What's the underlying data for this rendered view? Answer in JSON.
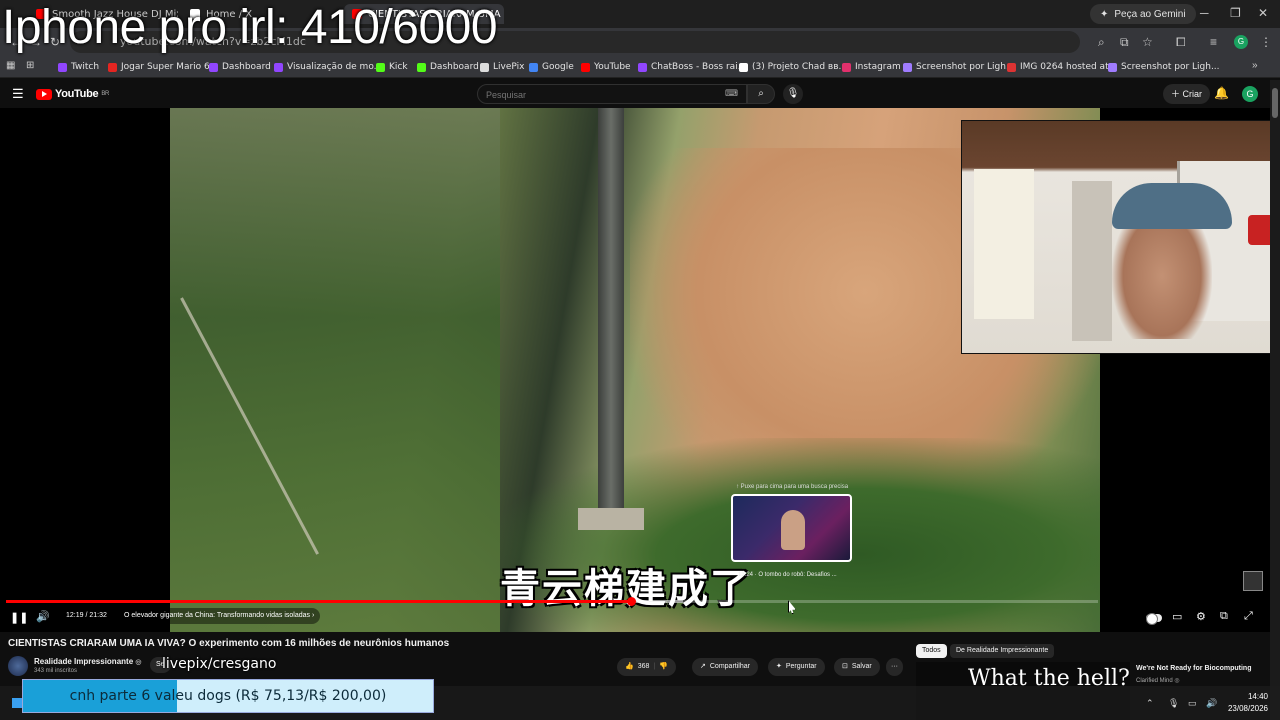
{
  "overlay": {
    "stream_title": "Iphone pro irl: 410/6000",
    "pix_text": "livepix/cresgano"
  },
  "browser": {
    "tabs": [
      {
        "label": "Smooth Jazz House DJ Mix - Ca",
        "favicon": "youtube-icon",
        "color": "#ff0000"
      },
      {
        "label": "Home / X",
        "favicon": "x-icon",
        "color": "#ffffff"
      },
      {
        "label": "CIENTISTAS CRIARAM UMA IA VIVA?",
        "favicon": "youtube-icon",
        "color": "#ff0000"
      }
    ],
    "gemini_label": "Peça ao Gemini",
    "url": "youtube.com/watch?v=zb2cM1dc",
    "bookmarks": [
      {
        "label": "Twitch",
        "color": "#9146ff"
      },
      {
        "label": "Jogar Super Mario 6...",
        "color": "#e52521"
      },
      {
        "label": "Dashboard",
        "color": "#9146ff"
      },
      {
        "label": "Visualização de mo...",
        "color": "#9146ff"
      },
      {
        "label": "Kick",
        "color": "#53fc18"
      },
      {
        "label": "Dashboard",
        "color": "#53fc18"
      },
      {
        "label": "LivePix",
        "color": "#dddddd"
      },
      {
        "label": "Google",
        "color": "#4285f4"
      },
      {
        "label": "YouTube",
        "color": "#ff0000"
      },
      {
        "label": "ChatBoss - Boss rai...",
        "color": "#9146ff"
      },
      {
        "label": "(3) Projeto Chad вв...",
        "color": "#ffffff"
      },
      {
        "label": "Instagram",
        "color": "#e1306c"
      },
      {
        "label": "Screenshot por Ligh...",
        "color": "#a07cff"
      },
      {
        "label": "IMG 0264 hosted at...",
        "color": "#d33"
      },
      {
        "label": "Screenshot por Ligh...",
        "color": "#a07cff"
      }
    ]
  },
  "youtube": {
    "logo_text": "YouTube",
    "logo_region": "BR",
    "search_placeholder": "Pesquisar",
    "create_label": "Criar",
    "avatar_letter": "G"
  },
  "player": {
    "subtitle": "青云梯建成了",
    "preview_hint": "↑ Puxe para cima para uma busca precisa",
    "preview_caption": "13:24 · O tombo do robô: Desafios ...",
    "time": "12:19 / 21:32",
    "chapter": "O elevador gigante da China: Transformando vidas isoladas ›",
    "progress_fraction": 0.572,
    "buffer_fraction": 0.62
  },
  "video": {
    "title": "CIENTISTAS CRIARAM UMA IA VIVA? O experimento com 16 milhões de neurônios humanos",
    "channel_name": "Realidade Impressionante",
    "channel_verified": "◎",
    "subscribers": "343 mil inscritos",
    "subscribe_label": "Se",
    "likes": "368",
    "share_label": "Compartilhar",
    "ask_label": "Perguntar",
    "save_label": "Salvar",
    "more_label": "···"
  },
  "sidebar": {
    "chip_all": "Todos",
    "chip_channel": "De Realidade Impressionante",
    "rec_thumb_text": "What the hell?",
    "rec_title": "We're Not Ready for Biocomputing",
    "rec_channel": "Clarified Mind ◎"
  },
  "donation": {
    "text": "cnh parte 6 valeu dogs (R$ 75,13/R$ 200,00)",
    "progress_fraction": 0.3757
  },
  "taskbar": {
    "time": "14:40",
    "date": "23/08/2026"
  }
}
